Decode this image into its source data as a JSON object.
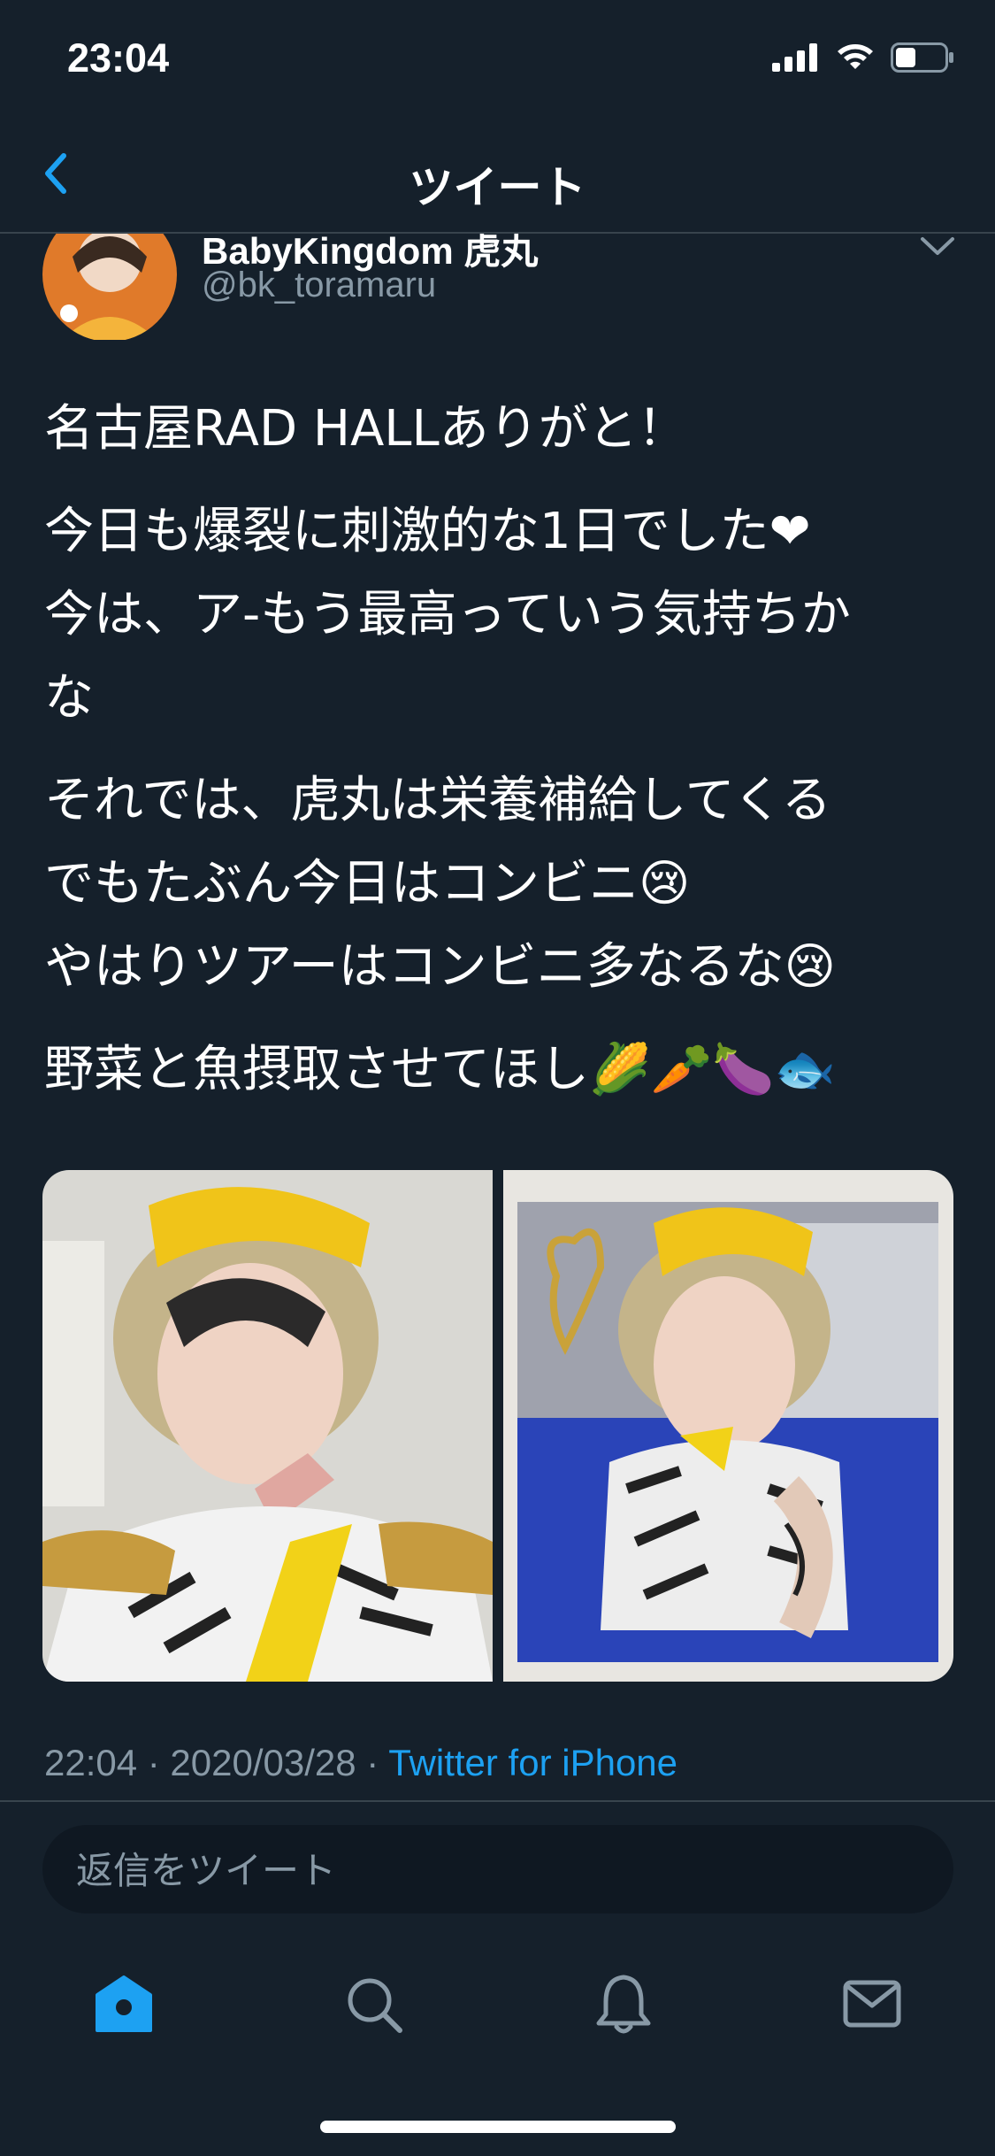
{
  "status_bar": {
    "time": "23:04"
  },
  "nav": {
    "title": "ツイート"
  },
  "author": {
    "name": "BabyKingdom 虎丸",
    "handle": "@bk_toramaru"
  },
  "tweet": {
    "paragraphs": [
      [
        "名古屋RAD HALLありがと！"
      ],
      [
        "今日も爆裂に刺激的な1日でした❤",
        "今は、ア-もう最高っていう気持ちか",
        "な"
      ],
      [
        "それでは、虎丸は栄養補給してくる",
        "でもたぶん今日はコンビニ😢",
        "やはりツアーはコンビニ多なるな😢"
      ],
      [
        "野菜と魚摂取させてほし🌽🥕🍆🐟"
      ]
    ]
  },
  "media": {
    "photo_count": 2
  },
  "meta": {
    "timestamp": "22:04 · 2020/03/28 · ",
    "source": "Twitter for iPhone"
  },
  "reply": {
    "placeholder": "返信をツイート"
  },
  "tabs": [
    "home-icon",
    "search-icon",
    "bell-icon",
    "mail-icon"
  ],
  "colors": {
    "background": "#15202b",
    "accent": "#1da1f2",
    "secondary_text": "#8899a6",
    "divider": "#38444d"
  }
}
